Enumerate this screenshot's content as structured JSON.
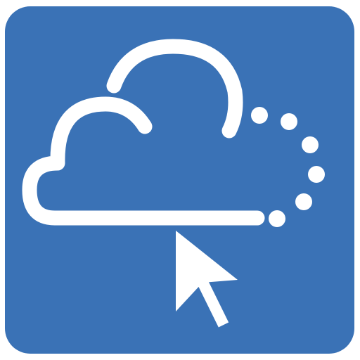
{
  "app_icon": {
    "icon": "cloud-pointer-icon",
    "background_color": "#3a72b6",
    "foreground_color": "#ffffff",
    "elements": {
      "cloud": "cloud-icon",
      "loading_dots": "loading-dots-icon",
      "cursor": "mouse-pointer-icon"
    },
    "loading_dot_count": 6
  }
}
